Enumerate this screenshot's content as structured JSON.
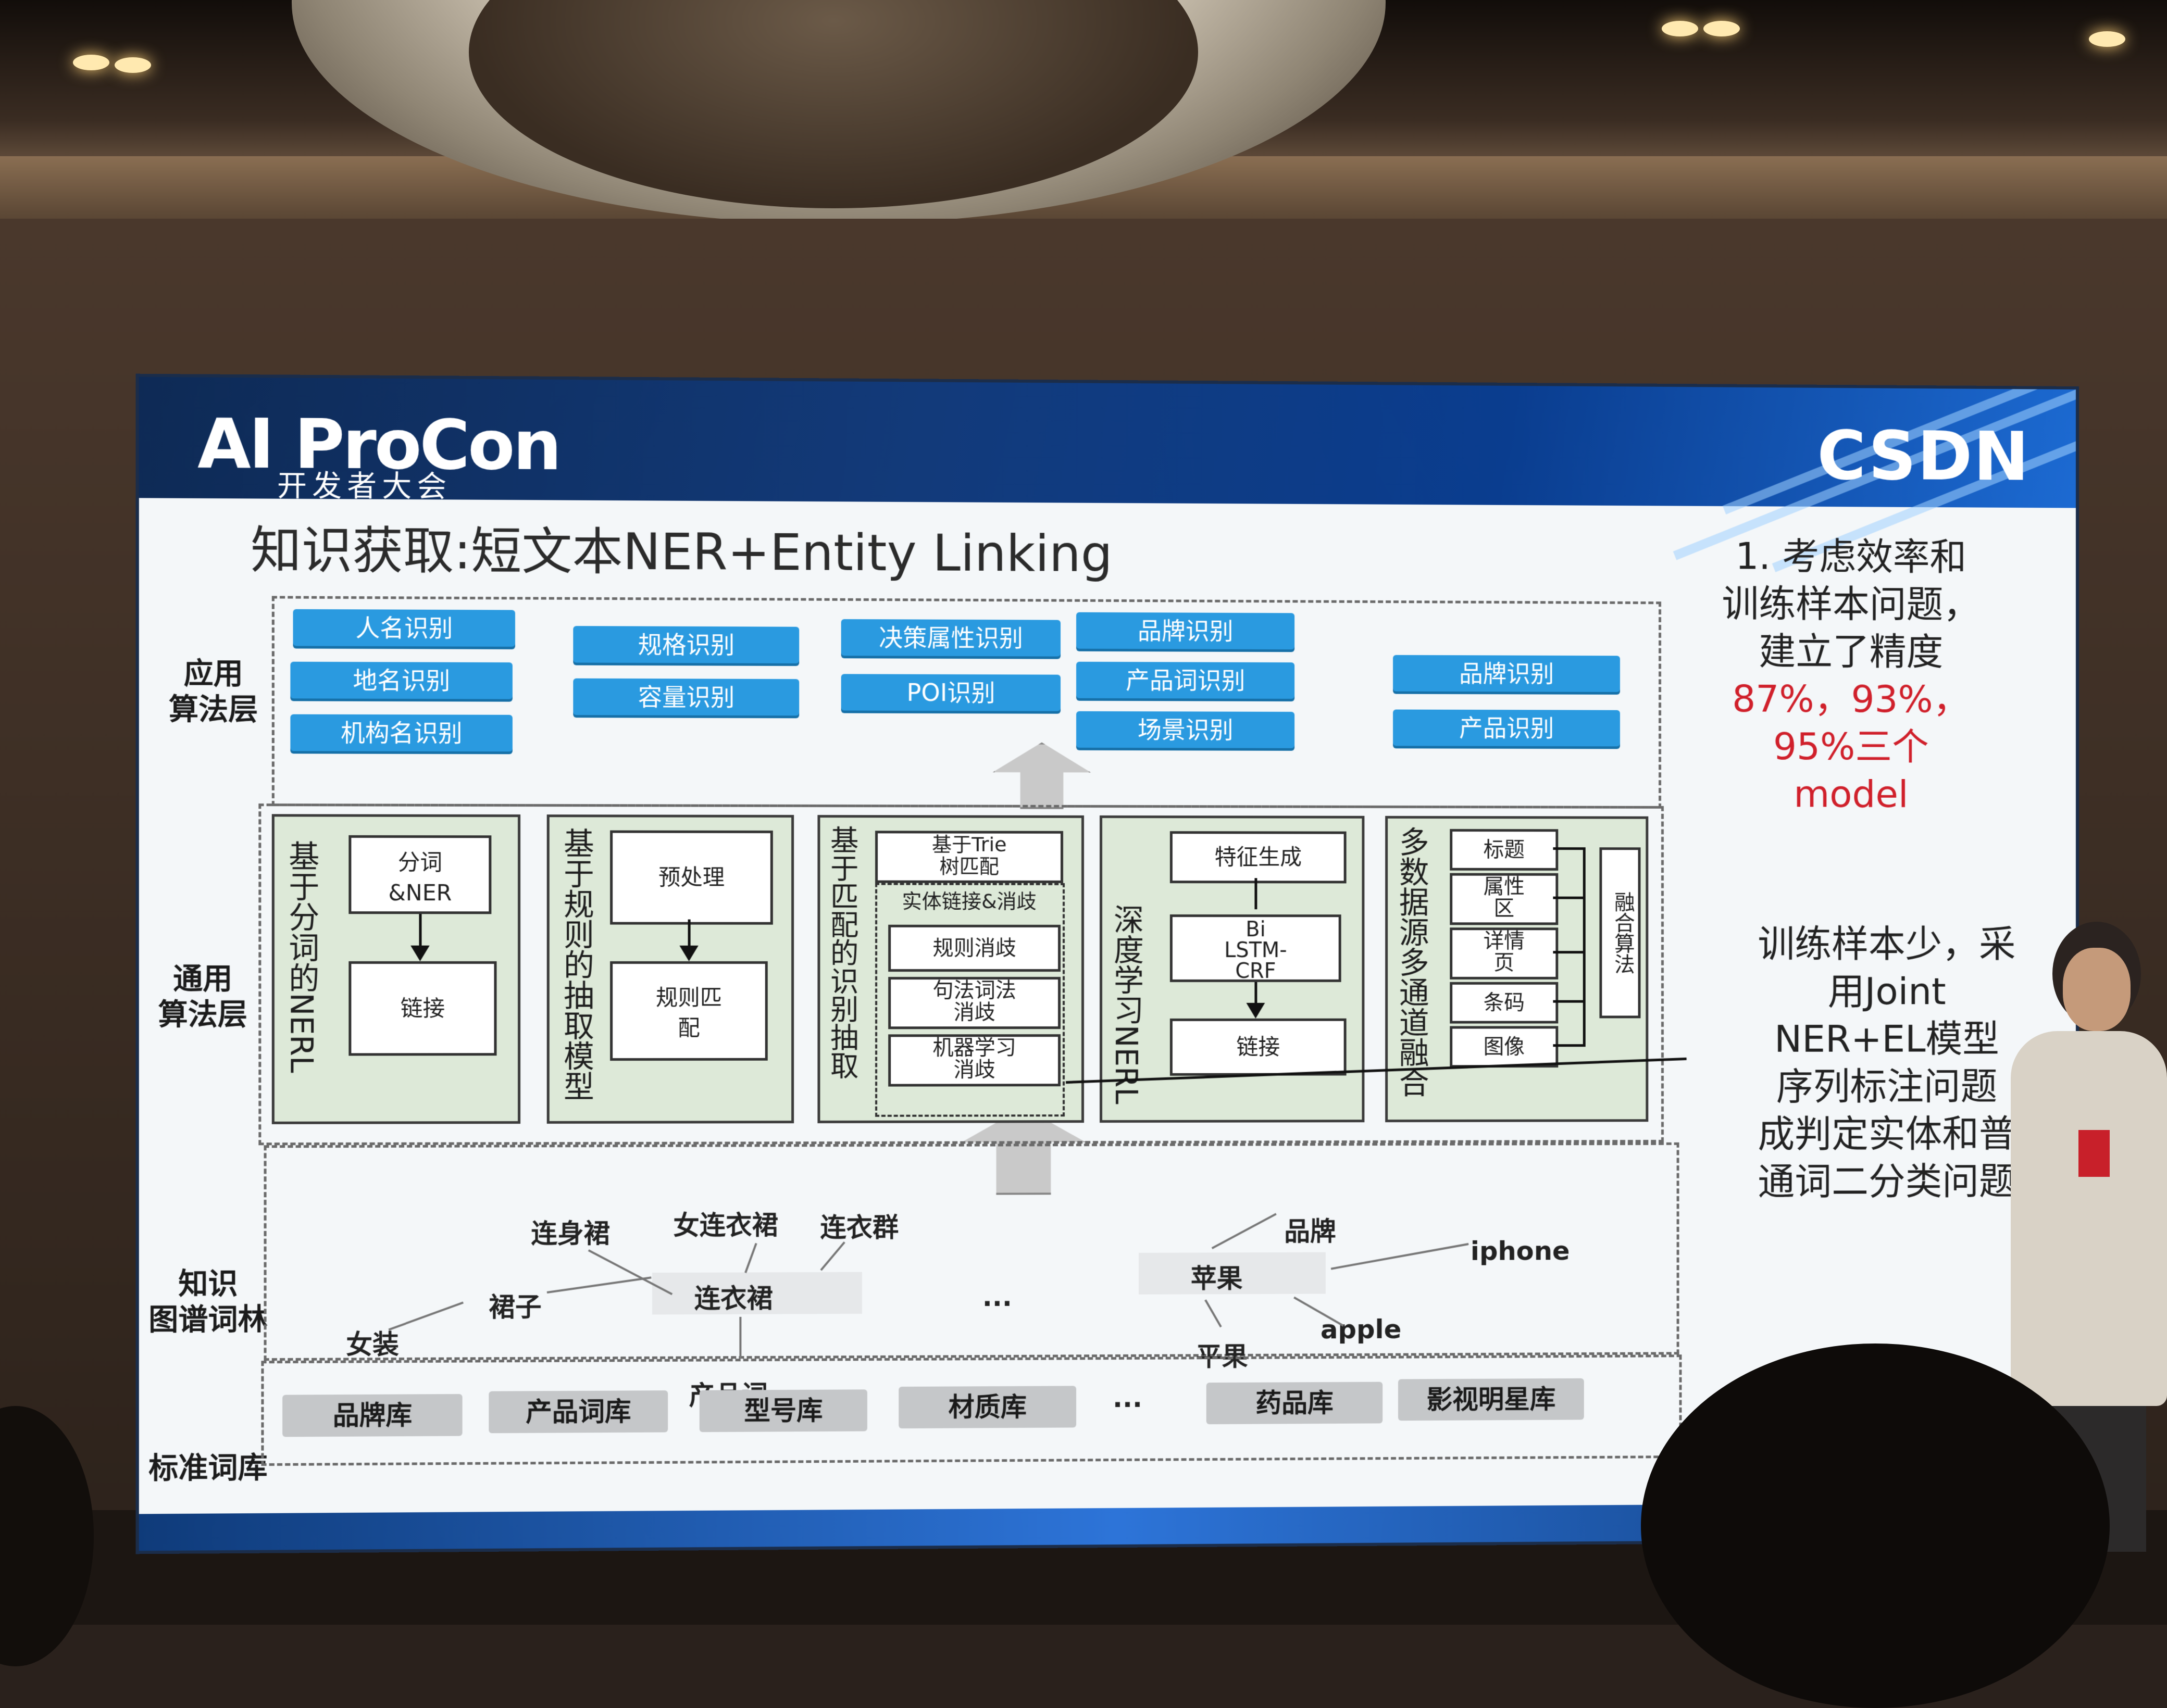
{
  "slide": {
    "logo_main": "AI ProCon",
    "logo_sub": "开发者大会",
    "brand_right": "CSDN",
    "title": "知识获取:短文本NER+Entity Linking"
  },
  "layers": {
    "app": "应用\n算法层",
    "general": "通用\n算法层",
    "kg": "知识\n图谱词林",
    "standard": "标准词库"
  },
  "app_tags": [
    "人名识别",
    "地名识别",
    "机构名识别",
    "规格识别",
    "容量识别",
    "决策属性识别",
    "POI识别",
    "品牌识别",
    "产品词识别",
    "场景识别",
    "品牌识别",
    "产品识别"
  ],
  "general": {
    "col1_title": "基于分词的NERL",
    "col1_boxes": [
      "分词\n&NER",
      "链接"
    ],
    "col2_title": "基于规则的抽取模型",
    "col2_boxes": [
      "预处理",
      "规则匹\n配"
    ],
    "col3_title": "基于匹配的识别抽取",
    "col3_boxes": [
      "基于Trie\n树匹配",
      "实体链接&消歧",
      "规则消歧",
      "句法词法\n消歧",
      "机器学习\n消歧"
    ],
    "col4_title": "深度学习NERL",
    "col4_boxes": [
      "特征生成",
      "Bi\nLSTM-\nCRF",
      "链接"
    ],
    "col5_title": "多数据源多通道融合",
    "col5_boxes": [
      "标题",
      "属性\n区",
      "详情\n页",
      "条码",
      "图像"
    ],
    "col5_fusion": "融合算法"
  },
  "kg_words": {
    "w1": "连身裙",
    "w2": "女连衣裙",
    "w3": "连衣群",
    "w4": "裙子",
    "w5": "连衣裙",
    "w6": "女装",
    "w7": "产品词",
    "w8": "...",
    "w9": "品牌",
    "w10": "苹果",
    "w11": "iphone",
    "w12": "apple",
    "w13": "平果"
  },
  "standard_libs": [
    "品牌库",
    "产品词库",
    "型号库",
    "材质库",
    "...",
    "药品库",
    "影视明星库"
  ],
  "side_note1": {
    "line1": "1. 考虑效率和",
    "line2": "训练样本问题，",
    "line3": "建立了精度",
    "line4": "87%，93%，",
    "line5": "95%三个",
    "line6": "model",
    "red_color": "#d0202b"
  },
  "side_note2": {
    "line1": "训练样本少，采",
    "line2": "用Joint",
    "line3": "NER+EL模型",
    "line4": "序列标注问题",
    "line5": "成判定实体和普",
    "line6": "通词二分类问题"
  }
}
